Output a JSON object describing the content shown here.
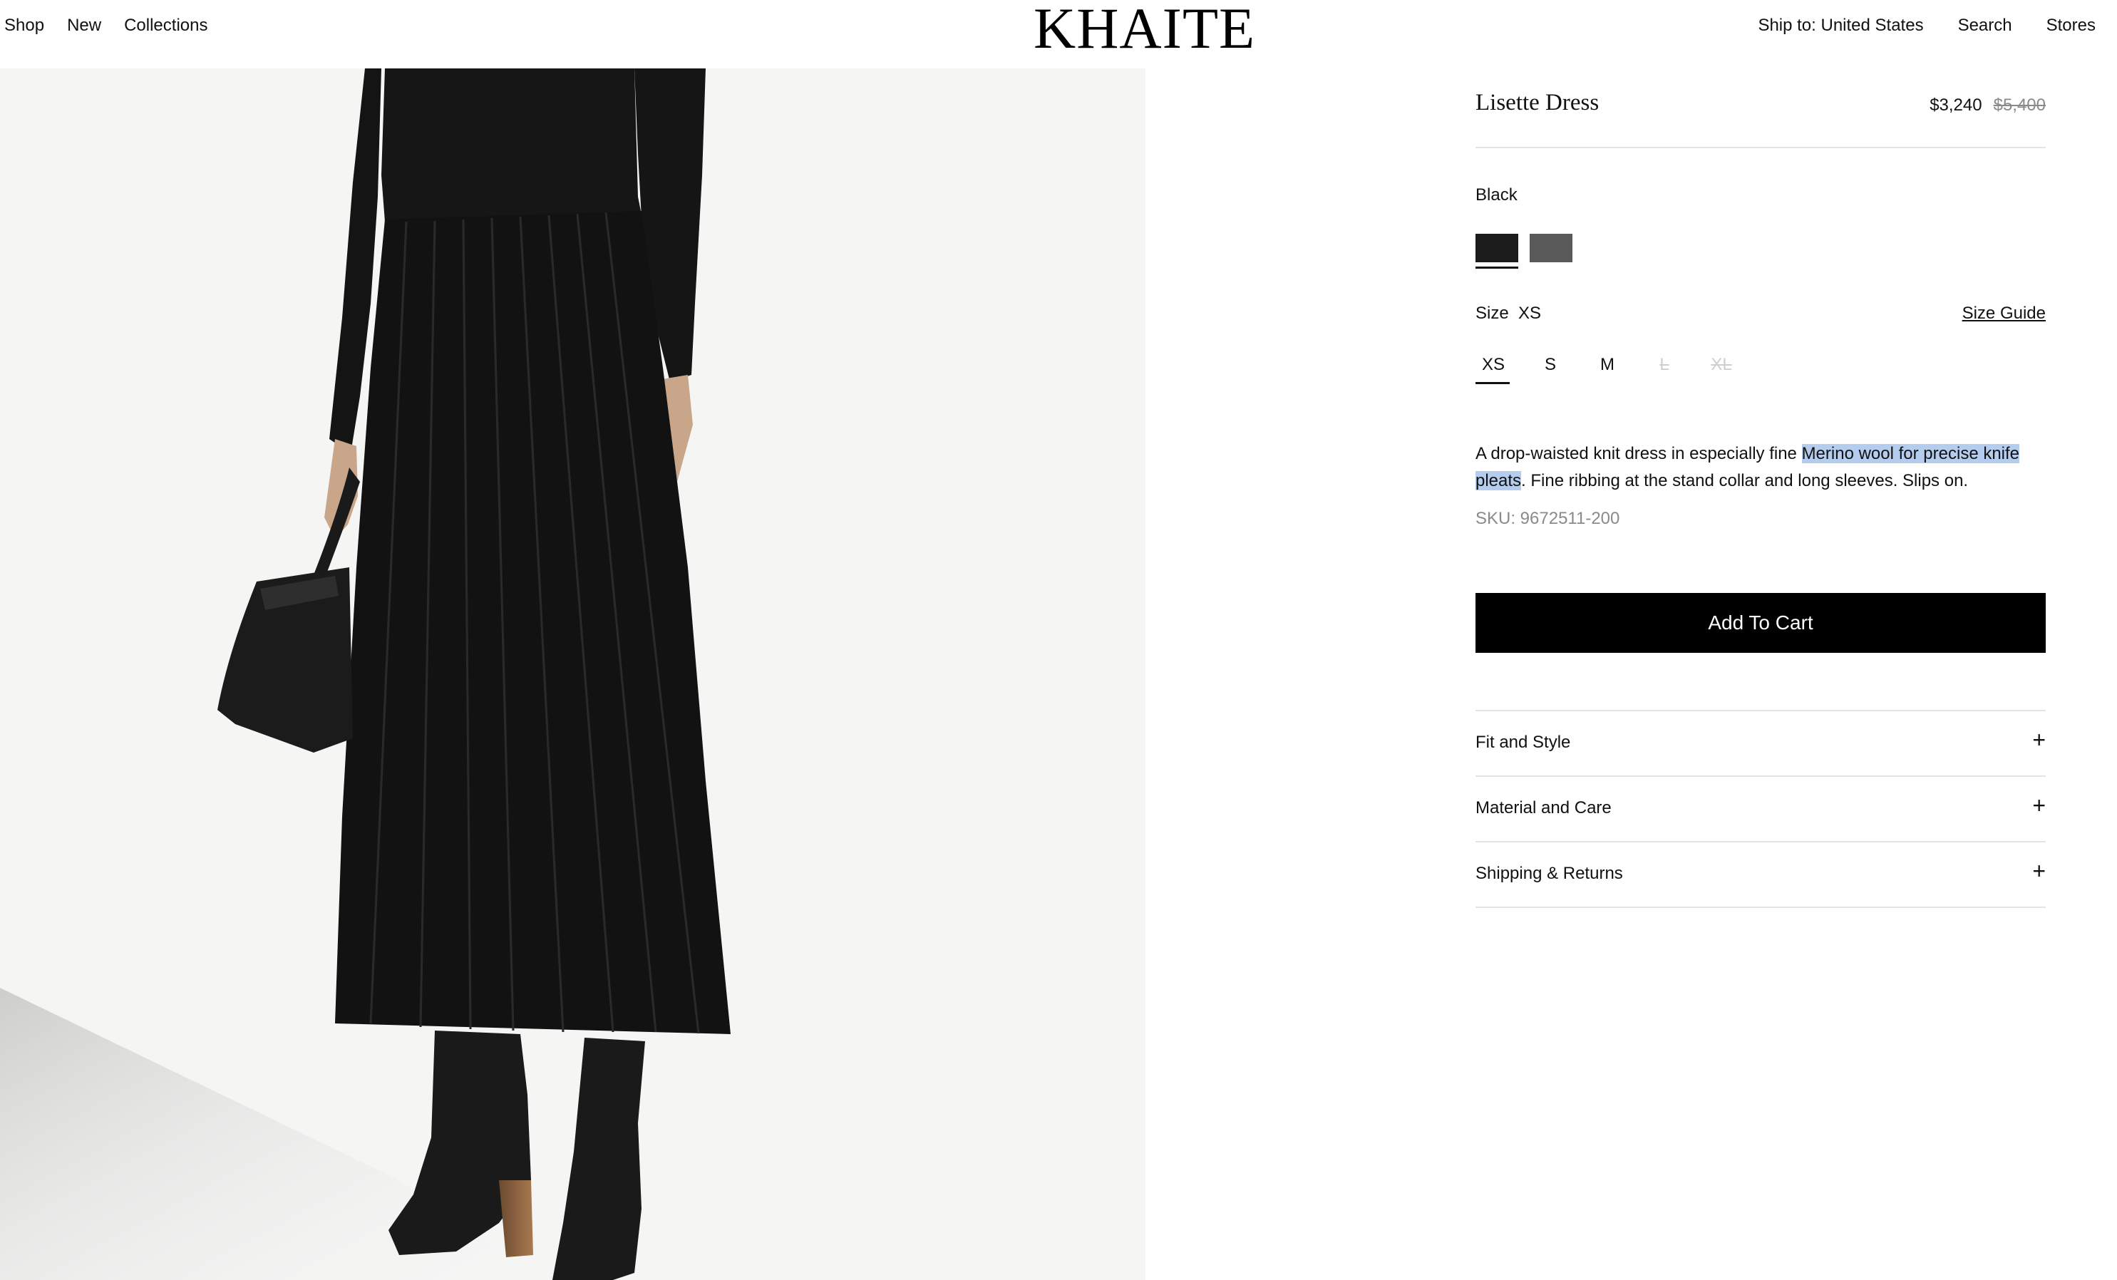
{
  "header": {
    "nav_left": [
      "Shop",
      "New",
      "Collections"
    ],
    "logo": "KHAITE",
    "nav_right": [
      "Ship to: United States",
      "Search",
      "Stores"
    ]
  },
  "product": {
    "name": "Lisette Dress",
    "price_current": "$3,240",
    "price_original": "$5,400",
    "color_label": "Black",
    "swatches": [
      {
        "name": "Black",
        "color": "#1c1c1c",
        "selected": true
      },
      {
        "name": "Gray",
        "color": "#595959",
        "selected": false
      }
    ],
    "size_label": "Size",
    "size_selected": "XS",
    "size_guide": "Size Guide",
    "sizes": [
      {
        "label": "XS",
        "available": true,
        "selected": true
      },
      {
        "label": "S",
        "available": true,
        "selected": false
      },
      {
        "label": "M",
        "available": true,
        "selected": false
      },
      {
        "label": "L",
        "available": false,
        "selected": false
      },
      {
        "label": "XL",
        "available": false,
        "selected": false
      }
    ],
    "description": {
      "part1": "A drop-waisted knit dress in especially fine ",
      "highlighted": "Merino wool for precise knife pleats",
      "part2": ". Fine ribbing at the stand collar and long sleeves. Slips on."
    },
    "sku": "SKU: 9672511-200",
    "add_to_cart": "Add To Cart",
    "accordion": [
      {
        "label": "Fit and Style",
        "icon": "plus-icon",
        "symbol": "+"
      },
      {
        "label": "Material and Care",
        "icon": "plus-icon",
        "symbol": "+"
      },
      {
        "label": "Shipping & Returns",
        "icon": "plus-icon",
        "symbol": "+"
      }
    ]
  },
  "colors": {
    "accent": "#000000",
    "highlight": "#b4cdef",
    "muted_text": "#8a8a8a",
    "image_background": "#f5f5f4"
  }
}
